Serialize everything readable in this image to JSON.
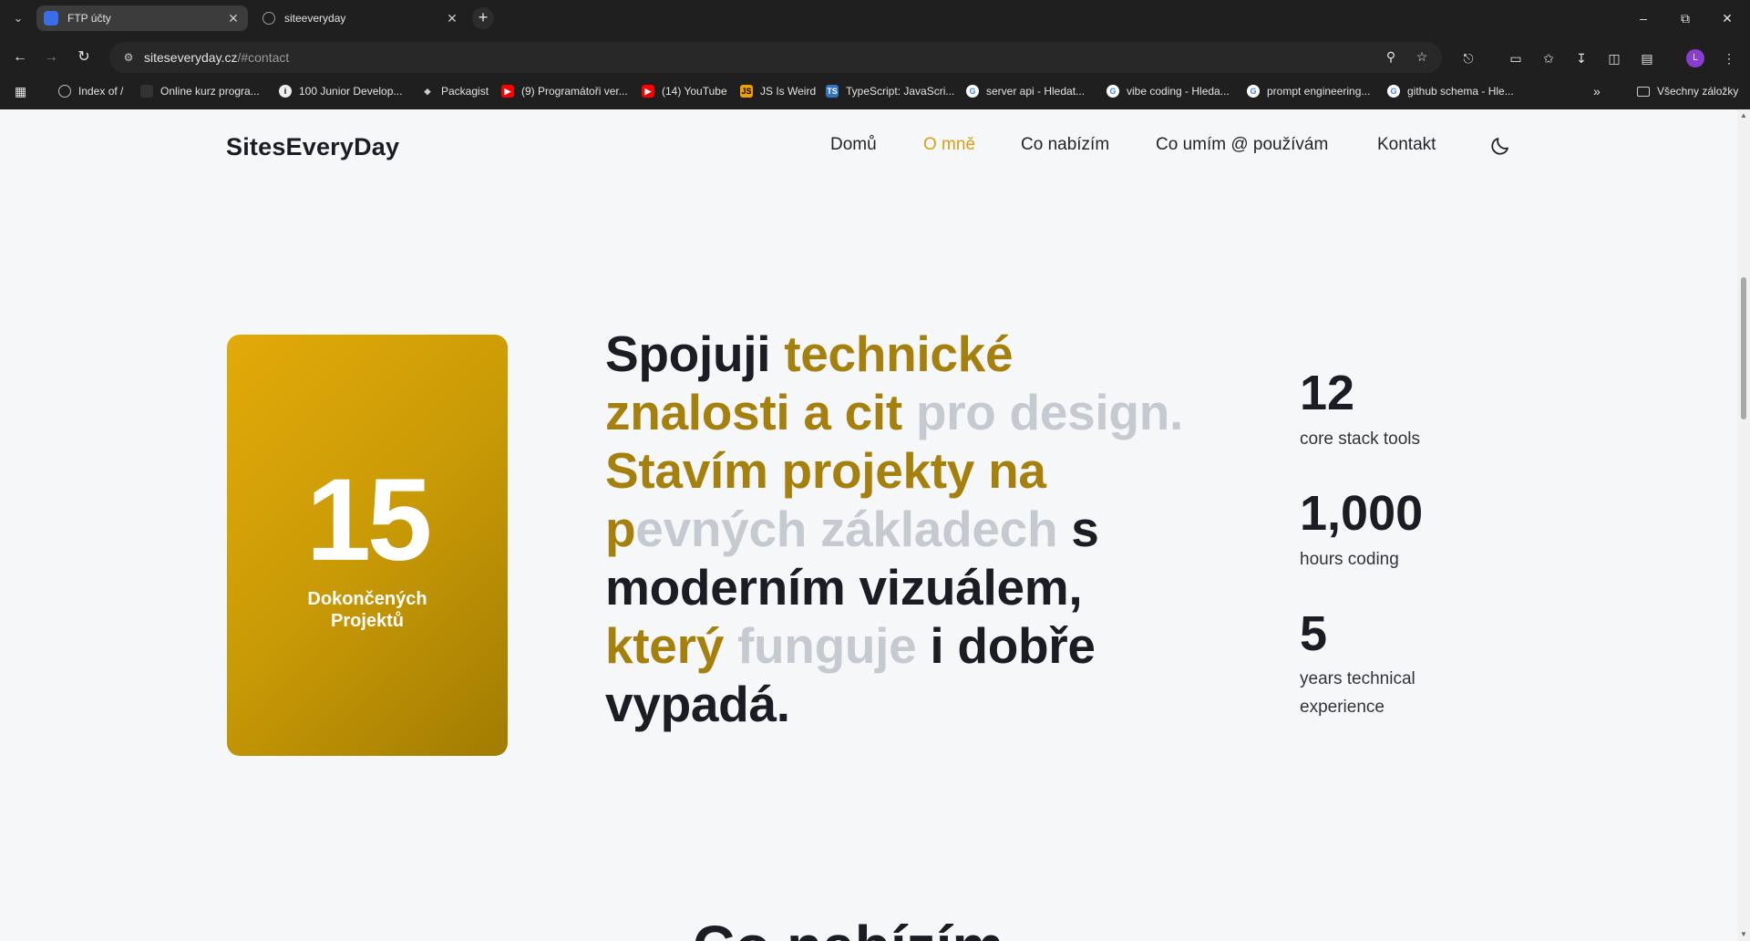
{
  "browser": {
    "tabs": [
      {
        "title": "FTP účty",
        "active": true
      },
      {
        "title": "siteeveryday",
        "active": false
      }
    ],
    "address": {
      "host": "siteseveryday.cz",
      "path": "/#contact"
    },
    "bookmarks": [
      "Index of /",
      "Online kurz progra...",
      "100 Junior Develop...",
      "Packagist",
      "(9) Programátoři ver...",
      "(14) YouTube",
      "JS Is Weird",
      "TypeScript: JavaScri...",
      "server api - Hledat...",
      "vibe coding - Hleda...",
      "prompt engineering...",
      "github schema - Hle..."
    ],
    "all_bookmarks": "Všechny záložky",
    "profile_initial": "L"
  },
  "site": {
    "logo": "SitesEveryDay",
    "nav": [
      "Domů",
      "O mně",
      "Co nabízím",
      "Co umím @ používám",
      "Kontakt"
    ],
    "active_nav": "O mně",
    "accent_color": "#d4a017"
  },
  "about": {
    "card": {
      "number": "15",
      "label_line1": "Dokončených",
      "label_line2": "Projektů"
    },
    "headline": {
      "l1_dark": "Spojuji ",
      "l1_gold": "technické",
      "l2_gold": "znalosti a cit",
      "l2_grey": " pro design.",
      "l3_gold": "Stavím projekty na",
      "l4_gold": "p",
      "l4_grey": "evných základech",
      "l4_dark": " s",
      "l5_dark": "moderním vizuálem,",
      "l6_gold": "který",
      "l6_grey": " funguje",
      "l6_dark": " i dobře",
      "l7_dark": "vypadá."
    },
    "stats": [
      {
        "value": "12",
        "label": "core stack tools"
      },
      {
        "value": "1,000",
        "label": "hours coding"
      },
      {
        "value": "5",
        "label": "years technical experience"
      }
    ]
  },
  "next_section": {
    "heading_partial": "Co nabízím"
  }
}
